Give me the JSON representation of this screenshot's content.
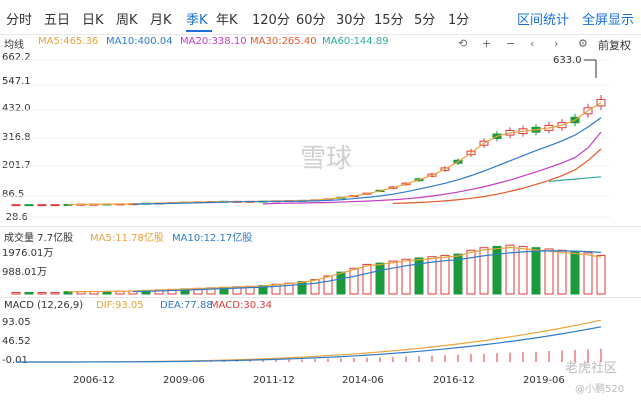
{
  "tabs": [
    {
      "label": "分时",
      "active": false
    },
    {
      "label": "五日",
      "active": false
    },
    {
      "label": "日K",
      "active": false
    },
    {
      "label": "周K",
      "active": false
    },
    {
      "label": "月K",
      "active": false
    },
    {
      "label": "季K",
      "active": true
    },
    {
      "label": "年K",
      "active": false
    },
    {
      "label": "120分",
      "active": false
    },
    {
      "label": "60分",
      "active": false
    },
    {
      "label": "30分",
      "active": false
    },
    {
      "label": "15分",
      "active": false
    },
    {
      "label": "5分",
      "active": false
    },
    {
      "label": "1分",
      "active": false
    }
  ],
  "header_links": {
    "range_stats": "区间统计",
    "fullscreen": "全屏显示"
  },
  "price_legend": [
    {
      "text": "均线",
      "color": "#333333"
    },
    {
      "text": "MA5:465.36",
      "color": "#e8a33c"
    },
    {
      "text": "MA10:400.04",
      "color": "#2f7bc9"
    },
    {
      "text": "MA20:338.10",
      "color": "#c43bc4"
    },
    {
      "text": "MA30:265.40",
      "color": "#e65a2c"
    },
    {
      "text": "MA60:144.89",
      "color": "#2fa89a"
    }
  ],
  "toolbar": {
    "adjust_label": "前复权",
    "icons": [
      "undo-icon",
      "zoom-in-icon",
      "zoom-out-icon",
      "pan-left-icon",
      "pan-right-icon",
      "settings-icon",
      "battery-icon"
    ]
  },
  "price_axis": [
    "662.2",
    "547.1",
    "432.0",
    "316.8",
    "201.7",
    "86.5",
    "-28.6"
  ],
  "max_label": "633.0",
  "volume_legend": [
    {
      "text": "成交量 7.7亿股",
      "color": "#333333"
    },
    {
      "text": "MA5:11.78亿股",
      "color": "#e8a33c"
    },
    {
      "text": "MA10:12.17亿股",
      "color": "#2f7bc9"
    }
  ],
  "volume_axis": [
    "1976.01万",
    "988.01万"
  ],
  "macd_legend": [
    {
      "text": "MACD (12,26,9)",
      "color": "#333333"
    },
    {
      "text": "DIF:93.05",
      "color": "#e8a33c"
    },
    {
      "text": "DEA:77.88",
      "color": "#2f7bc9"
    },
    {
      "text": "MACD:30.34",
      "color": "#e23a3a"
    }
  ],
  "macd_axis": [
    "93.05",
    "46.52",
    "-0.01"
  ],
  "x_labels": [
    "2006-12",
    "2009-06",
    "2011-12",
    "2014-06",
    "2016-12",
    "2019-06"
  ],
  "watermarks": {
    "center": "雪球",
    "bottom_right": "老虎社区",
    "user": "@小鹏520"
  },
  "colors": {
    "up": "#e23a3a",
    "down": "#1a9a3a",
    "accent": "#1a6fd6"
  },
  "chart_data": {
    "type": "candlestick",
    "price_series": [
      {
        "name": "MA5",
        "values": [
          null,
          null,
          null,
          null,
          25,
          26,
          26,
          27,
          27,
          28,
          30,
          31,
          33,
          35,
          36,
          37,
          38,
          38,
          38,
          39,
          40,
          41,
          42,
          44,
          48,
          55,
          62,
          72,
          84,
          98,
          114,
          132,
          152,
          178,
          210,
          248,
          290,
          320,
          335,
          342,
          348,
          356,
          368,
          390,
          430,
          465
        ]
      },
      {
        "name": "MA10",
        "values": [
          null,
          null,
          null,
          null,
          null,
          null,
          null,
          null,
          null,
          26,
          28,
          29,
          30,
          31,
          33,
          34,
          36,
          37,
          38,
          38,
          39,
          39,
          40,
          41,
          43,
          46,
          51,
          56,
          62,
          70,
          80,
          92,
          104,
          117,
          132,
          150,
          170,
          192,
          214,
          236,
          258,
          278,
          300,
          325,
          360,
          400
        ]
      },
      {
        "name": "MA20",
        "values": [
          null,
          null,
          null,
          null,
          null,
          null,
          null,
          null,
          null,
          null,
          null,
          null,
          null,
          null,
          null,
          null,
          null,
          null,
          null,
          28,
          30,
          31,
          32,
          33,
          34,
          36,
          38,
          40,
          43,
          46,
          50,
          55,
          62,
          70,
          79,
          90,
          102,
          116,
          131,
          148,
          166,
          185,
          205,
          228,
          270,
          338
        ]
      },
      {
        "name": "MA30",
        "values": [
          null,
          null,
          null,
          null,
          null,
          null,
          null,
          null,
          null,
          null,
          null,
          null,
          null,
          null,
          null,
          null,
          null,
          null,
          null,
          null,
          null,
          null,
          null,
          null,
          null,
          null,
          null,
          null,
          null,
          30,
          32,
          34,
          37,
          41,
          46,
          52,
          60,
          70,
          82,
          96,
          112,
          130,
          150,
          175,
          215,
          265
        ]
      },
      {
        "name": "MA60",
        "values": [
          null,
          null,
          null,
          null,
          null,
          null,
          null,
          null,
          null,
          null,
          null,
          null,
          null,
          null,
          null,
          null,
          null,
          null,
          null,
          null,
          null,
          null,
          null,
          null,
          null,
          null,
          null,
          null,
          null,
          null,
          null,
          null,
          null,
          null,
          null,
          null,
          null,
          null,
          null,
          null,
          null,
          125,
          130,
          135,
          140,
          145
        ]
      }
    ],
    "volume_series": [
      {
        "name": "MA5",
        "values": [
          null,
          null,
          null,
          null,
          90,
          95,
          100,
          105,
          110,
          120,
          140,
          160,
          180,
          200,
          220,
          240,
          260,
          280,
          300,
          330,
          380,
          420,
          480,
          560,
          700,
          850,
          1000,
          1150,
          1200,
          1280,
          1350,
          1400,
          1450,
          1500,
          1550,
          1700,
          1800,
          1850,
          1900,
          1850,
          1800,
          1750,
          1700,
          1650,
          1600,
          1500
        ]
      },
      {
        "name": "MA10",
        "values": [
          null,
          null,
          null,
          null,
          null,
          null,
          null,
          null,
          null,
          100,
          110,
          125,
          140,
          160,
          180,
          200,
          220,
          240,
          260,
          280,
          310,
          350,
          390,
          440,
          520,
          620,
          720,
          840,
          960,
          1060,
          1150,
          1230,
          1300,
          1360,
          1400,
          1480,
          1560,
          1620,
          1680,
          1720,
          1750,
          1760,
          1760,
          1750,
          1730,
          1700
        ]
      }
    ],
    "macd": {
      "dif": 93.05,
      "dea": 77.88,
      "macd": 30.34
    },
    "ylim_price": [
      -28.6,
      662.2
    ],
    "max_price": 633.0
  }
}
